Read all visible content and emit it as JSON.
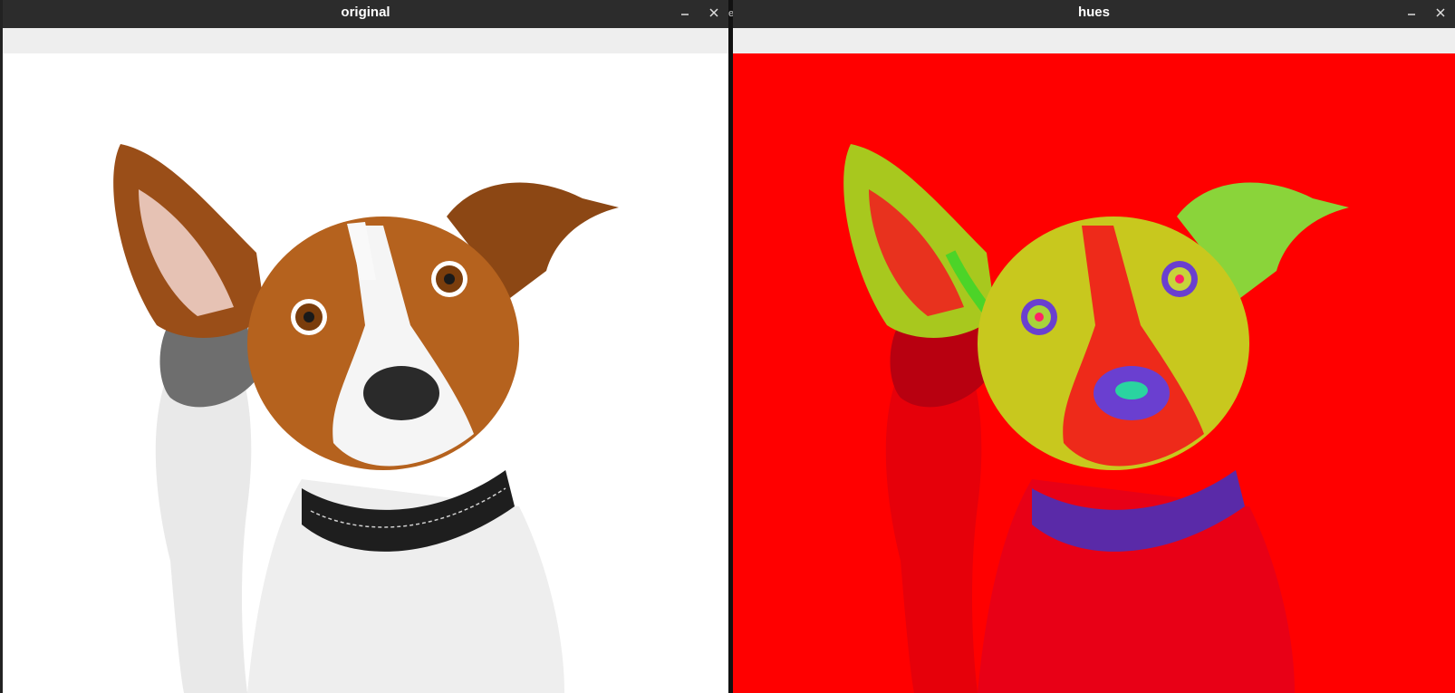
{
  "windows": {
    "left": {
      "title": "original",
      "minimize_glyph": "–",
      "close_glyph": "✕",
      "image_description": "dog"
    },
    "right": {
      "title": "hues",
      "minimize_glyph": "–",
      "close_glyph": "✕",
      "image_description": "hue-map"
    }
  },
  "colors": {
    "titlebar": "#2c2c2c",
    "toolbar": "#eeeeee",
    "hue_background": "#ff0000",
    "hue_yellow": "#c8c81e",
    "hue_green": "#4cd428",
    "hue_purple": "#6a3fd0"
  },
  "separator_char": "e"
}
